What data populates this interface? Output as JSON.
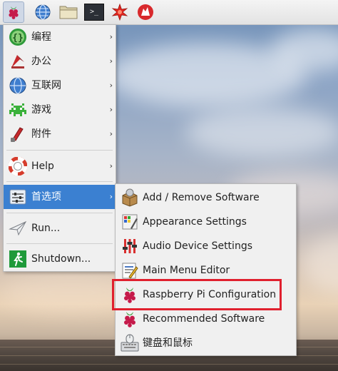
{
  "main_menu": {
    "items": [
      {
        "label": "编程",
        "icon": "programming-icon",
        "has_submenu": true
      },
      {
        "label": "办公",
        "icon": "office-icon",
        "has_submenu": true
      },
      {
        "label": "互联网",
        "icon": "internet-icon",
        "has_submenu": true
      },
      {
        "label": "游戏",
        "icon": "games-icon",
        "has_submenu": true
      },
      {
        "label": "附件",
        "icon": "accessories-icon",
        "has_submenu": true
      },
      {
        "label": "Help",
        "icon": "help-icon",
        "has_submenu": true
      },
      {
        "label": "首选项",
        "icon": "preferences-icon",
        "has_submenu": true,
        "selected": true
      },
      {
        "label": "Run...",
        "icon": "run-icon",
        "has_submenu": false
      },
      {
        "label": "Shutdown...",
        "icon": "shutdown-icon",
        "has_submenu": false
      }
    ],
    "arrow_glyph": "›"
  },
  "preferences_submenu": {
    "items": [
      {
        "label": "Add / Remove Software",
        "icon": "package-icon"
      },
      {
        "label": "Appearance Settings",
        "icon": "appearance-icon"
      },
      {
        "label": "Audio Device Settings",
        "icon": "audio-icon"
      },
      {
        "label": "Main Menu Editor",
        "icon": "menu-editor-icon"
      },
      {
        "label": "Raspberry Pi Configuration",
        "icon": "raspberry-icon",
        "highlighted": true
      },
      {
        "label": "Recommended Software",
        "icon": "raspberry-icon"
      },
      {
        "label": "键盘和鼠标",
        "icon": "keyboard-mouse-icon"
      }
    ]
  },
  "taskbar": {
    "icons": [
      "raspberry-menu-icon",
      "web-browser-icon",
      "file-manager-icon",
      "terminal-icon",
      "mathematica-icon",
      "wolfram-icon"
    ],
    "terminal_glyph": ">_"
  },
  "colors": {
    "selection": "#3b80d1",
    "highlight_border": "#e0202e",
    "menu_bg": "#f0f0f0"
  }
}
